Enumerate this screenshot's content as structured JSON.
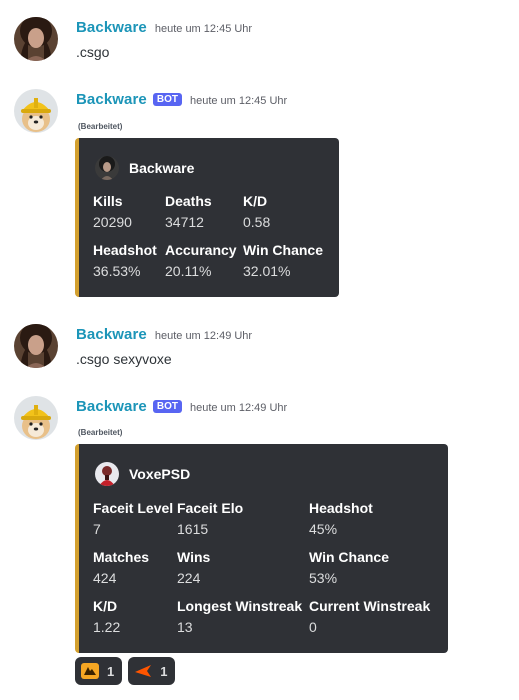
{
  "messages": [
    {
      "username": "Backware",
      "timestamp": "heute um 12:45 Uhr",
      "content": ".csgo"
    },
    {
      "username": "Backware",
      "bot_tag": "BOT",
      "timestamp": "heute um 12:45 Uhr",
      "edited": "(Bearbeitet)",
      "embed": {
        "author": "Backware",
        "fields": [
          {
            "name": "Kills",
            "value": "20290"
          },
          {
            "name": "Deaths",
            "value": "34712"
          },
          {
            "name": "K/D",
            "value": "0.58"
          },
          {
            "name": "Headshot",
            "value": "36.53%"
          },
          {
            "name": "Accurancy",
            "value": "20.11%"
          },
          {
            "name": "Win Chance",
            "value": "32.01%"
          }
        ]
      }
    },
    {
      "username": "Backware",
      "timestamp": "heute um 12:49 Uhr",
      "content": ".csgo sexyvoxe"
    },
    {
      "username": "Backware",
      "bot_tag": "BOT",
      "timestamp": "heute um 12:49 Uhr",
      "edited": "(Bearbeitet)",
      "embed": {
        "author": "VoxePSD",
        "fields": [
          {
            "name": "Faceit Level",
            "value": "7"
          },
          {
            "name": "Faceit Elo",
            "value": "1615"
          },
          {
            "name": "Headshot",
            "value": "45%"
          },
          {
            "name": "Matches",
            "value": "424"
          },
          {
            "name": "Wins",
            "value": "224"
          },
          {
            "name": "Win Chance",
            "value": "53%"
          },
          {
            "name": "K/D",
            "value": "1.22"
          },
          {
            "name": "Longest Winstreak",
            "value": "13"
          },
          {
            "name": "Current Winstreak",
            "value": "0"
          }
        ]
      },
      "reactions": [
        {
          "emoji": "faceit-logo-icon",
          "count": "1"
        },
        {
          "emoji": "faceit-arrow-icon",
          "count": "1"
        }
      ]
    }
  ],
  "colors": {
    "username": "#1c95b8",
    "bot_tag": "#5865f2",
    "embed_bg": "#2f3136",
    "embed_accent": "#d3a02f"
  }
}
